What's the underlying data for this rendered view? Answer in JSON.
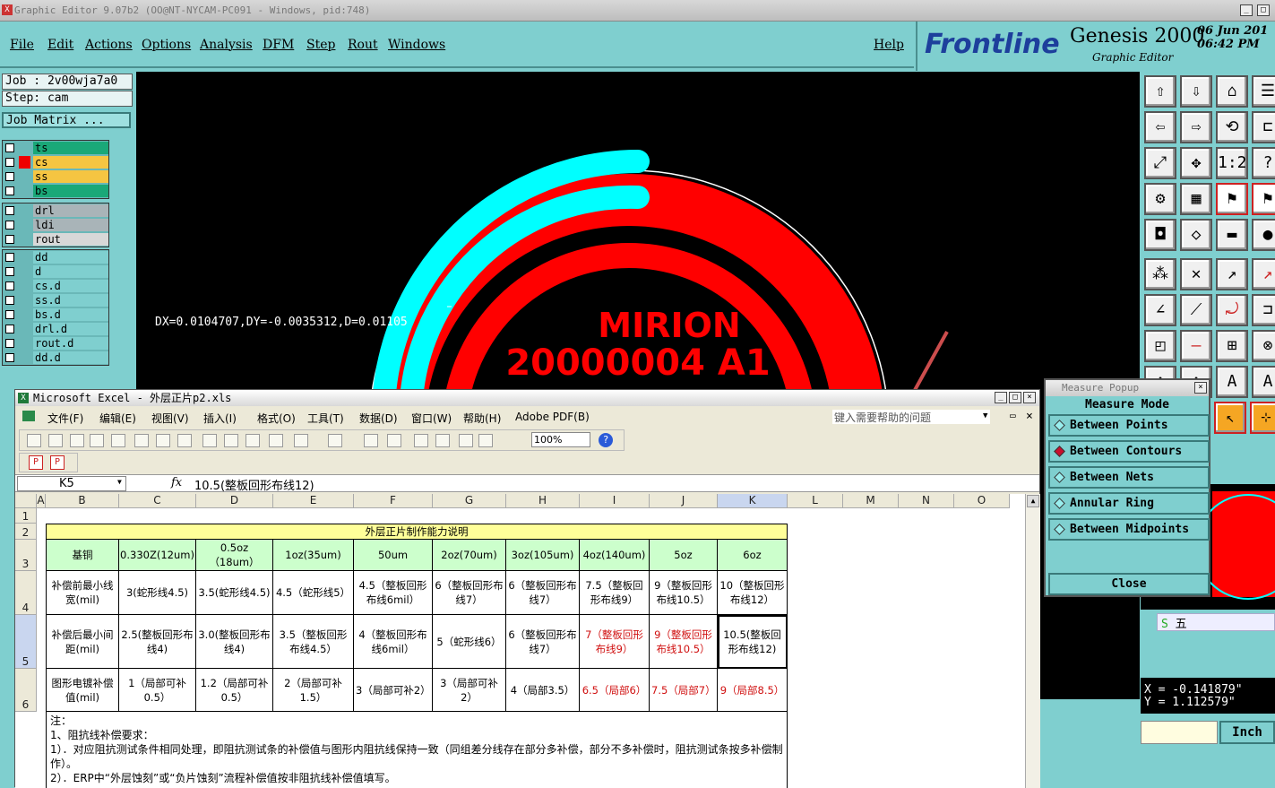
{
  "window_title": "Graphic Editor 9.07b2 (OO@NT-NYCAM-PC091 - Windows, pid:748)",
  "menu": [
    "File",
    "Edit",
    "Actions",
    "Options",
    "Analysis",
    "DFM",
    "Step",
    "Rout",
    "Windows"
  ],
  "help": "Help",
  "brand": {
    "logo": "Frontline",
    "product": "Genesis 2000",
    "subtitle": "Graphic Editor",
    "date": "06 Jun 201",
    "time": "06:42 PM"
  },
  "job": "Job : 2v00wja7a0",
  "step": "Step: cam",
  "job_matrix": "Job Matrix ...",
  "layers_group1": [
    {
      "name": "ts",
      "color": "#1aa878"
    },
    {
      "name": "cs",
      "color": "#f5c542"
    },
    {
      "name": "ss",
      "color": "#f5c542"
    },
    {
      "name": "bs",
      "color": "#1aa878"
    }
  ],
  "layers_group2": [
    {
      "name": "drl",
      "color": "#a9b4b8"
    },
    {
      "name": "ldi",
      "color": "#a9b4b8"
    },
    {
      "name": "rout",
      "color": "#d8d8d8"
    }
  ],
  "layers_group3": [
    {
      "name": "dd",
      "color": "#7fcfcf"
    },
    {
      "name": "d",
      "color": "#7fcfcf"
    },
    {
      "name": "cs.d",
      "color": "#7fcfcf"
    },
    {
      "name": "ss.d",
      "color": "#7fcfcf"
    },
    {
      "name": "bs.d",
      "color": "#7fcfcf"
    },
    {
      "name": "drl.d",
      "color": "#7fcfcf"
    },
    {
      "name": "rout.d",
      "color": "#7fcfcf"
    },
    {
      "name": "dd.d",
      "color": "#7fcfcf"
    }
  ],
  "measure_readout": "DX=0.0104707,DY=-0.0035312,D=0.01105",
  "board_text": {
    "line1": "MIRION",
    "line2": "20000004 A1"
  },
  "excel": {
    "title": "Microsoft Excel - 外层正片p2.xls",
    "menu": [
      "文件(F)",
      "编辑(E)",
      "视图(V)",
      "插入(I)",
      "格式(O)",
      "工具(T)",
      "数据(D)",
      "窗口(W)",
      "帮助(H)",
      "Adobe PDF(B)"
    ],
    "help_placeholder": "键入需要帮助的问题",
    "zoom": "100%",
    "name_box": "K5",
    "formula": "10.5(整板回形布线12)",
    "columns": [
      "A",
      "B",
      "C",
      "D",
      "E",
      "F",
      "G",
      "H",
      "I",
      "J",
      "K",
      "L",
      "M",
      "N",
      "O"
    ],
    "rows": [
      "1",
      "2",
      "3",
      "4",
      "5",
      "6"
    ],
    "table_title": "外层正片制作能力说明",
    "headers": [
      "基铜",
      "0.330Z(12um)",
      "0.5oz（18um）",
      "1oz(35um)",
      "50um",
      "2oz(70um)",
      "3oz(105um)",
      "4oz(140um)",
      "5oz",
      "6oz"
    ],
    "row4": [
      "补偿前最小线宽(mil)",
      "3(蛇形线4.5)",
      "3.5(蛇形线4.5)",
      "4.5（蛇形线5）",
      "4.5（整板回形布线6mil）",
      "6（整板回形布线7）",
      "6（整板回形布线7）",
      "7.5（整板回形布线9）",
      "9（整板回形布线10.5）",
      "10（整板回形布线12）"
    ],
    "row5": [
      "补偿后最小间距(mil)",
      "2.5(整板回形布线4)",
      "3.0(整板回形布线4)",
      "3.5（整板回形布线4.5）",
      "4（整板回形布线6mil）",
      "5（蛇形线6）",
      "6（整板回形布线7）",
      "7（整板回形布线9）",
      "9（整板回形布线10.5）",
      "10.5(整板回形布线12)"
    ],
    "row6": [
      "图形电镀补偿值(mil)",
      "1（局部可补0.5）",
      "1.2（局部可补0.5）",
      "2（局部可补1.5）",
      "3（局部可补2）",
      "3（局部可补2）",
      "4（局部3.5）",
      "6.5（局部6）",
      "7.5（局部7）",
      "9（局部8.5）"
    ],
    "notes": [
      "注：",
      "1、阻抗线补偿要求：",
      "1）．对应阻抗测试条件相同处理，即阻抗测试条的补偿值与图形内阻抗线保持一致（同组差分线存在部分多补偿，部分不多补偿时，阻抗测试条按多补偿制作）。",
      "2）．ERP中“外层蚀刻”或“负片蚀刻”流程补偿值按非阻抗线补偿值填写。"
    ]
  },
  "measure_popup": {
    "title": "Measure Popup",
    "heading": "Measure Mode",
    "options": [
      "Between Points",
      "Between Contours",
      "Between Nets",
      "Annular Ring",
      "Between Midpoints"
    ],
    "selected": "Between Contours",
    "close": "Close"
  },
  "coords": {
    "x": "X = -0.141879\"",
    "y": "Y = 1.112579\""
  },
  "units": "Inch",
  "ime": "五"
}
